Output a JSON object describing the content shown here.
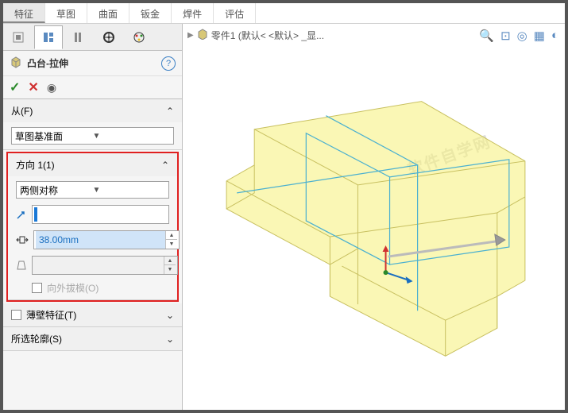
{
  "ribbon": {
    "tabs": [
      "特征",
      "草图",
      "曲面",
      "钣金",
      "焊件",
      "评估"
    ],
    "active": 0
  },
  "panel_tabs": {
    "active": 1
  },
  "feature": {
    "icon": "cube-icon",
    "title": "凸台-拉伸",
    "ok_label": "✓",
    "cancel_label": "✕"
  },
  "sections": {
    "from": {
      "title": "从(F)",
      "plane_value": "草图基准面"
    },
    "dir1": {
      "title": "方向 1(1)",
      "end_condition": "两侧对称",
      "reverse_value": "",
      "depth_value": "38.00mm",
      "draft_on": false,
      "draft_label": "向外拔模(O)",
      "draft_field": ""
    },
    "thin": {
      "title": "薄壁特征(T)",
      "checked": false
    },
    "contours": {
      "title": "所选轮廓(S)"
    }
  },
  "breadcrumb": {
    "part_label": "零件1  (默认< <默认> _显..."
  },
  "watermark": "软件自学网"
}
